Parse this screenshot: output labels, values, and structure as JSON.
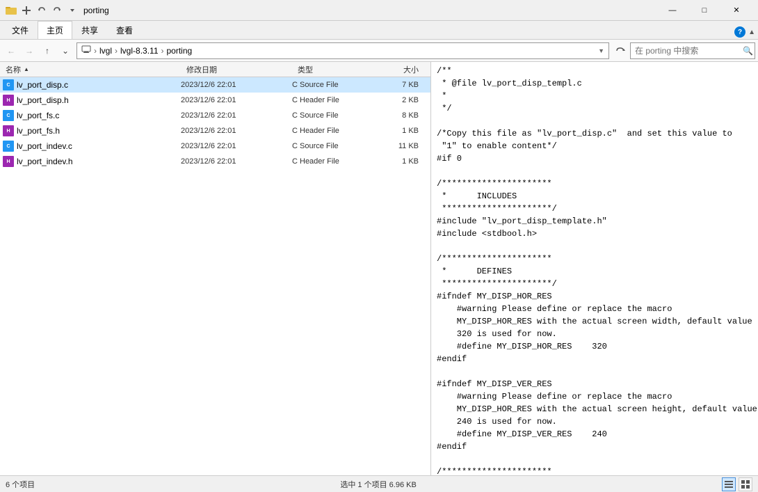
{
  "titleBar": {
    "title": "porting",
    "quickAccessIcons": [
      "new-folder-icon",
      "undo-icon",
      "redo-icon"
    ],
    "windowControls": {
      "minimize": "—",
      "maximize": "□",
      "close": "✕"
    }
  },
  "ribbonTabs": [
    {
      "label": "文件",
      "active": false
    },
    {
      "label": "主页",
      "active": true
    },
    {
      "label": "共享",
      "active": false
    },
    {
      "label": "查看",
      "active": false
    }
  ],
  "addressBar": {
    "breadcrumbs": [
      "lvgl",
      "lvgl-8.3.11",
      "porting"
    ],
    "searchPlaceholder": "在 porting 中搜索"
  },
  "columnHeaders": [
    {
      "label": "名称",
      "col": "name",
      "sortActive": true,
      "sortDir": "asc"
    },
    {
      "label": "修改日期",
      "col": "date"
    },
    {
      "label": "类型",
      "col": "type"
    },
    {
      "label": "大小",
      "col": "size"
    }
  ],
  "files": [
    {
      "name": "lv_port_disp.c",
      "date": "2023/12/6 22:01",
      "type": "C Source File",
      "size": "7 KB",
      "ext": "c",
      "selected": true
    },
    {
      "name": "lv_port_disp.h",
      "date": "2023/12/6 22:01",
      "type": "C Header File",
      "size": "2 KB",
      "ext": "h",
      "selected": false
    },
    {
      "name": "lv_port_fs.c",
      "date": "2023/12/6 22:01",
      "type": "C Source File",
      "size": "8 KB",
      "ext": "c",
      "selected": false
    },
    {
      "name": "lv_port_fs.h",
      "date": "2023/12/6 22:01",
      "type": "C Header File",
      "size": "1 KB",
      "ext": "h",
      "selected": false
    },
    {
      "name": "lv_port_indev.c",
      "date": "2023/12/6 22:01",
      "type": "C Source File",
      "size": "11 KB",
      "ext": "c",
      "selected": false
    },
    {
      "name": "lv_port_indev.h",
      "date": "2023/12/6 22:01",
      "type": "C Header File",
      "size": "1 KB",
      "ext": "h",
      "selected": false
    }
  ],
  "codeContent": "/**\n * @file lv_port_disp_templ.c\n *\n */\n\n/*Copy this file as \"lv_port_disp.c\"  and set this value to\n \"1\" to enable content*/\n#if 0\n\n/**********************\n *      INCLUDES\n **********************/\n#include \"lv_port_disp_template.h\"\n#include <stdbool.h>\n\n/**********************\n *      DEFINES\n **********************/\n#ifndef MY_DISP_HOR_RES\n    #warning Please define or replace the macro\n    MY_DISP_HOR_RES with the actual screen width, default value\n    320 is used for now.\n    #define MY_DISP_HOR_RES    320\n#endif\n\n#ifndef MY_DISP_VER_RES\n    #warning Please define or replace the macro\n    MY_DISP_HOR_RES with the actual screen height, default value\n    240 is used for now.\n    #define MY_DISP_VER_RES    240\n#endif\n\n/**********************\n *      TYPEDEFS\n **********************/",
  "statusBar": {
    "itemCount": "6 个项目",
    "selectedInfo": "选中 1 个项目  6.96 KB"
  }
}
